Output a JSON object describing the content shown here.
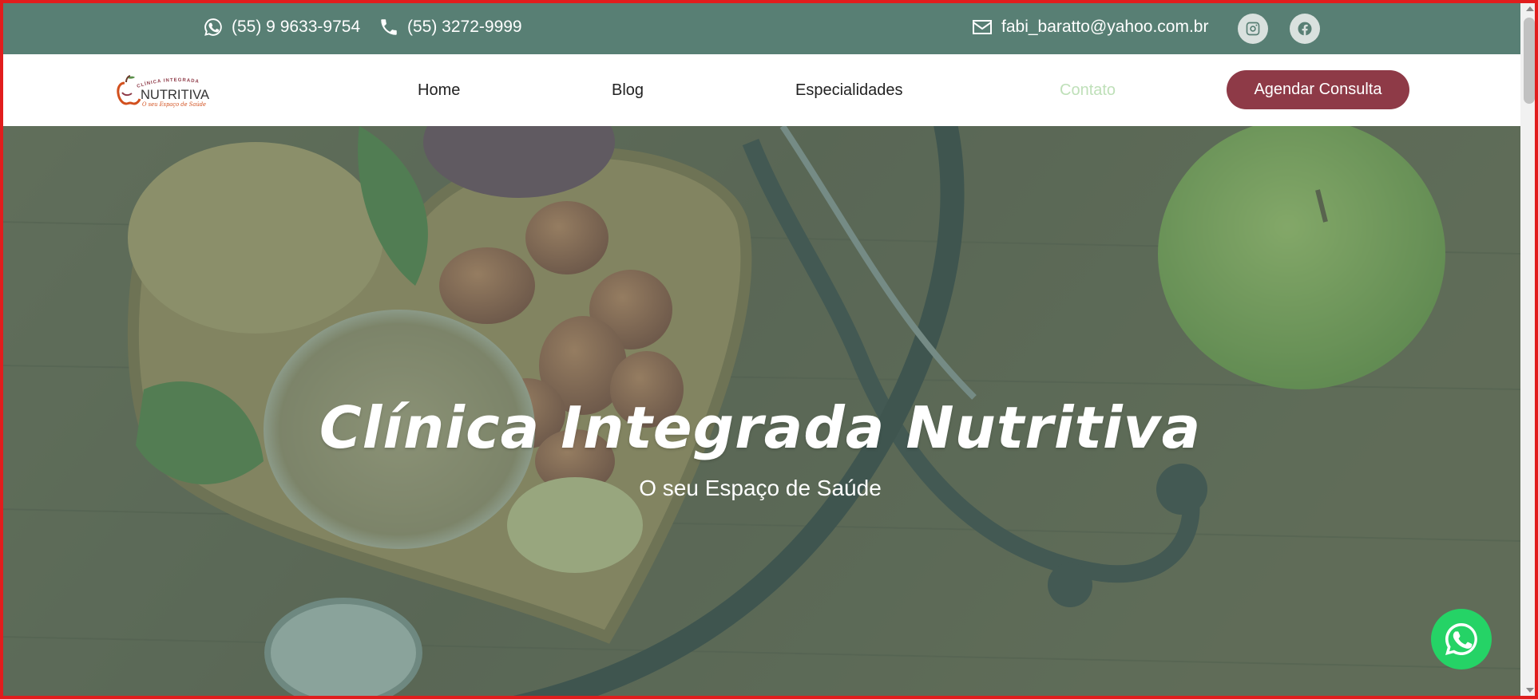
{
  "topbar": {
    "whatsapp_phone": "(55) 9 9633-9754",
    "phone": "(55) 3272-9999",
    "email": "fabi_baratto@yahoo.com.br",
    "icons": [
      "whatsapp-icon",
      "phone-icon",
      "envelope-icon",
      "instagram-icon",
      "facebook-icon"
    ]
  },
  "nav": {
    "links": [
      {
        "label": "Home"
      },
      {
        "label": "Blog"
      },
      {
        "label": "Especialidades"
      },
      {
        "label": "Contato"
      }
    ],
    "cta_label": "Agendar Consulta",
    "logo": {
      "brand": "NUTRITIVA",
      "arc_text": "CLÍNICA INTEGRADA",
      "tagline": "O seu Espaço de Saúde"
    }
  },
  "hero": {
    "title": "Clínica Integrada Nutritiva",
    "subtitle": "O seu Espaço de Saúde"
  },
  "colors": {
    "topbar": "#587f74",
    "cta": "#8e3a47",
    "active_link": "#bfe0b9",
    "whatsapp": "#25d366",
    "frame": "#e11d1d"
  }
}
